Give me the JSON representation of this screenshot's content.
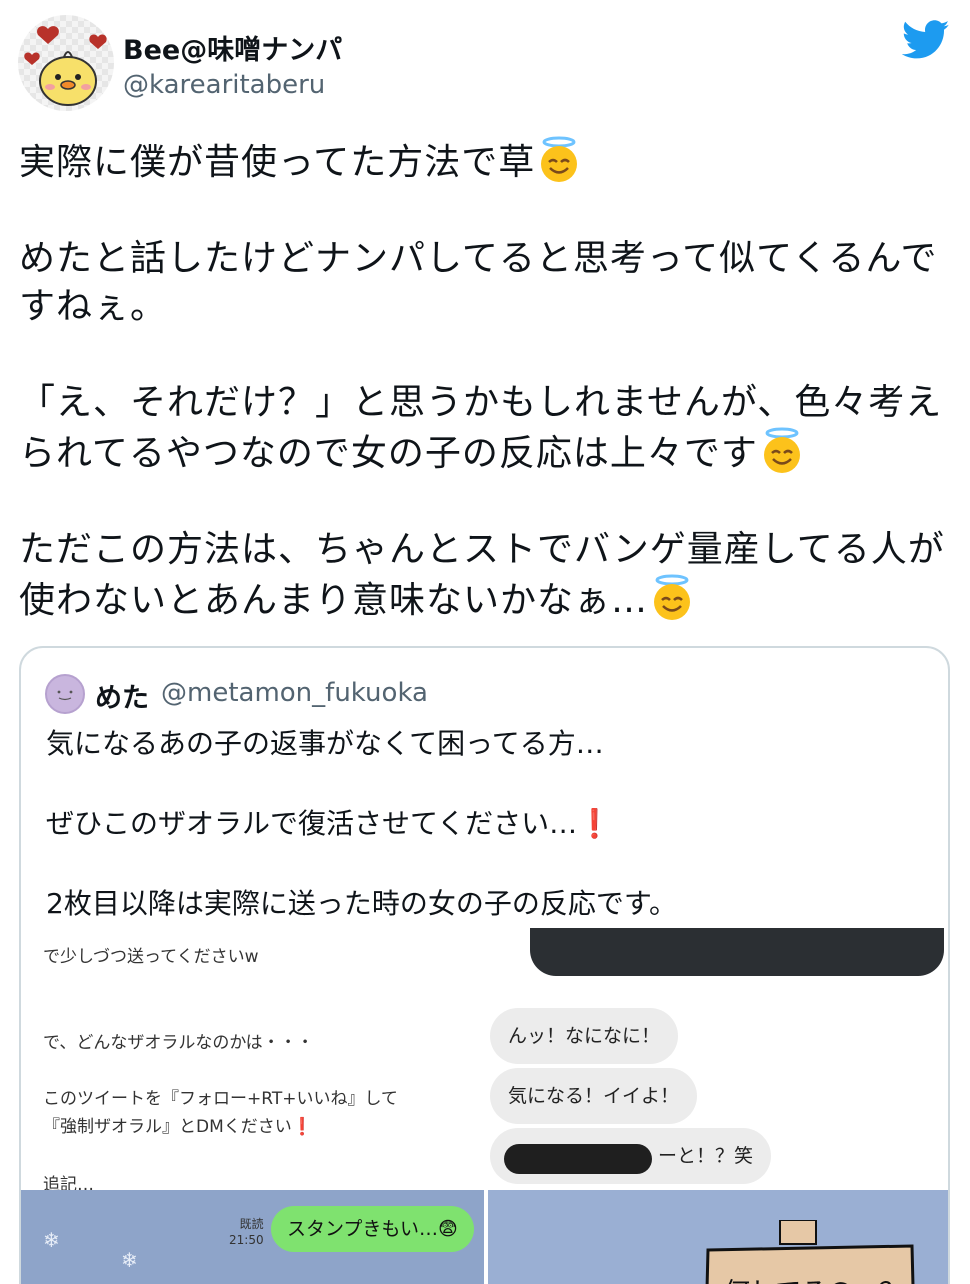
{
  "author": {
    "name": "Bee@味噌ナンパ",
    "handle": "@karearitaberu"
  },
  "icons": {
    "platform": "twitter-bird-icon",
    "emoji": "smiling-face-with-halo"
  },
  "colors": {
    "twitter_blue": "#1d9bf0",
    "handle_gray": "#536471",
    "card_border": "#cfd9de"
  },
  "tweet": {
    "p1": "実際に僕が昔使ってた方法で草",
    "p2": "めたと話したけどナンパしてると思考って似てくるんですねぇ。",
    "p3": "「え、それだけ？」と思うかもしれませんが、色々考えられてるやつなので女の子の反応は上々です",
    "p4": "ただこの方法は、ちゃんとストでバンゲ量産してる人が使わないとあんまり意味ないかなぁ…"
  },
  "quote": {
    "name": "めた",
    "handle": "@metamon_fukuoka",
    "p1": "気になるあの子の返事がなくて困ってる方…",
    "p2": "ぜひこのザオラルで復活させてください…",
    "p2_mark": "❗",
    "p3": "2枚目以降は実際に送った時の女の子の反応です。"
  },
  "media": {
    "img1": {
      "line1": "で少しづつ送ってくださいw",
      "line2": "で、どんなザオラルなのかは・・・",
      "line3": "このツイートを『フォロー+RT+いいね』して",
      "line4": "『強制ザオラル』とDMください",
      "line4_mark": "❗",
      "line5": "追記…"
    },
    "img2": {
      "bubble1": "んッ！なになに！",
      "bubble2": "気になる！イイよ！",
      "bubble3": "ーと！？笑"
    },
    "img3": {
      "read": "既読",
      "time": "21:50",
      "bubble": "スタンプきもい…😨"
    },
    "img4": {
      "handwritten": "何してるの〜？"
    }
  }
}
